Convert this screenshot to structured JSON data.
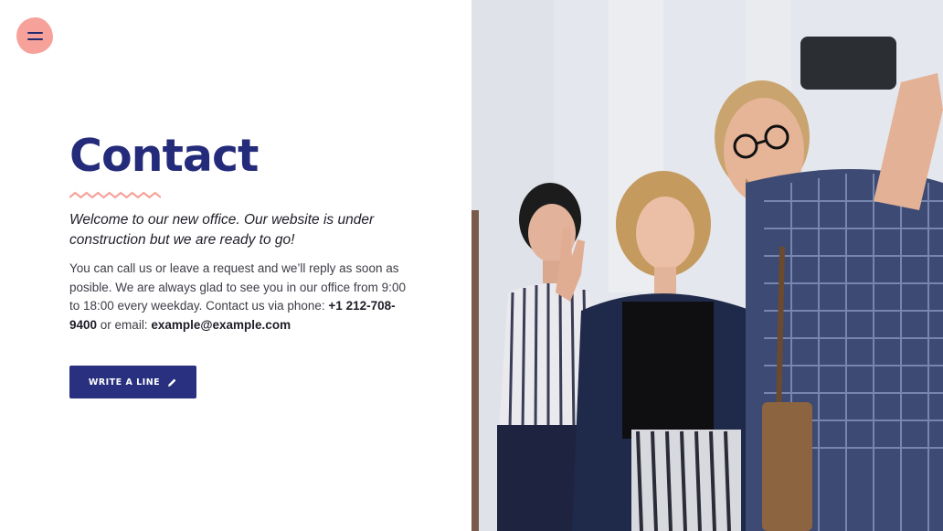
{
  "menu": {
    "icon": "hamburger-menu-icon"
  },
  "contact": {
    "title": "Contact",
    "lead": "Welcome to our new office. Our website is under construction but we are ready to go!",
    "body_prefix": "You can call us or leave a request and we’ll reply as soon as posible. We are always glad to see you in our office from 9:00 to 18:00 every weekday. Contact us via phone: ",
    "phone": "+1 212-708-9400",
    "body_mid": " or email: ",
    "email": "example@example.com"
  },
  "cta": {
    "label": "WRITE A LINE",
    "icon": "pencil-icon"
  },
  "colors": {
    "accent": "#242b7a",
    "blob": "#f6a29a",
    "button": "#28307f"
  }
}
